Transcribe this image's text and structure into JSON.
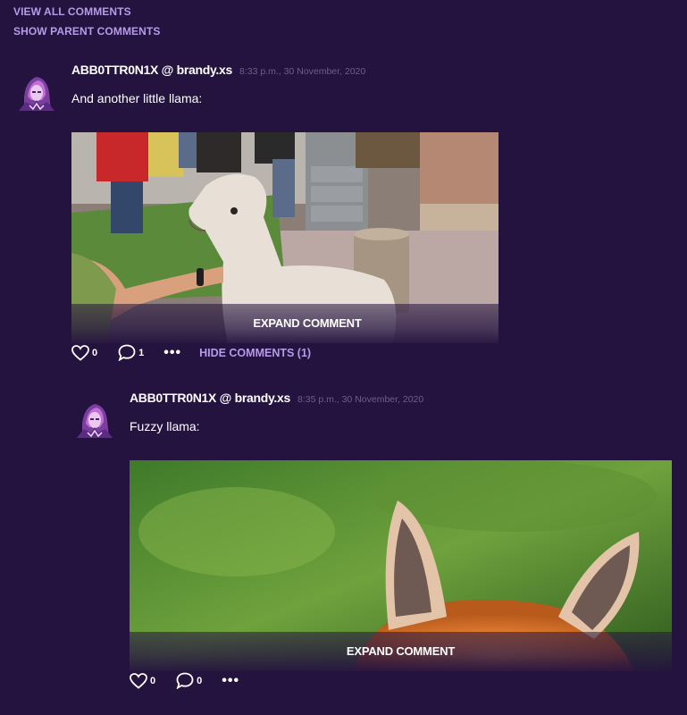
{
  "thread": {
    "view_all": "VIEW ALL COMMENTS",
    "show_parent": "SHOW PARENT COMMENTS"
  },
  "comments": [
    {
      "author": "ABB0TTR0N1X @ brandy.xs",
      "timestamp": "8:33 p.m., 30 November, 2020",
      "text": "And another little llama:",
      "expand_label": "EXPAND COMMENT",
      "likes": "0",
      "replies": "1",
      "hide_label": "HIDE COMMENTS (1)"
    },
    {
      "author": "ABB0TTR0N1X @ brandy.xs",
      "timestamp": "8:35 p.m., 30 November, 2020",
      "text": "Fuzzy llama:",
      "expand_label": "EXPAND COMMENT",
      "likes": "0",
      "replies": "0"
    }
  ],
  "icons": {
    "like": "heart-icon",
    "reply": "speech-bubble-icon",
    "more": "more-dots-icon"
  },
  "colors": {
    "background": "#24123f",
    "link": "#b69be8",
    "timestamp": "#6f5d8d"
  }
}
